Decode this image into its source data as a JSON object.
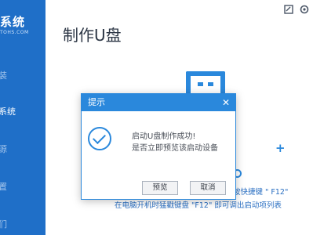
{
  "sidebar": {
    "brand": "系统",
    "brand_sub": "TOHS.COM",
    "items": [
      {
        "label": "装"
      },
      {
        "label": "系统"
      },
      {
        "label": "源"
      },
      {
        "label": "置"
      },
      {
        "label": "们"
      }
    ]
  },
  "header": {
    "title": "制作U盘"
  },
  "hints": {
    "line1": "按快捷键 \" F12\"",
    "line2": "在电脑开机时猛戳键盘 \"F12\" 即可调出启动项列表"
  },
  "dialog": {
    "title": "提示",
    "close_glyph": "✕",
    "message_line1": "启动U盘制作成功!",
    "message_line2": "是否立即预览该启动设备",
    "preview_button": "预览",
    "cancel_button": "取消"
  },
  "icons": {
    "feedback": "feedback-icon",
    "settings": "settings-icon"
  },
  "colors": {
    "accent": "#2a88dc",
    "sidebar": "#1f6fc8"
  }
}
